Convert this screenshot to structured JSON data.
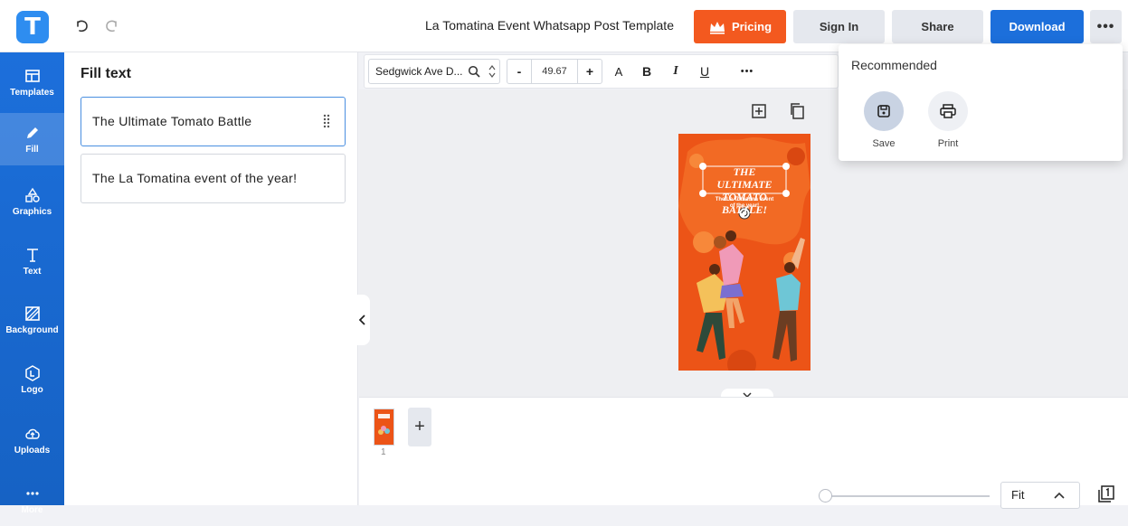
{
  "header": {
    "logo_letter": "T",
    "doc_title": "La Tomatina Event Whatsapp Post Template",
    "pricing_label": "Pricing",
    "signin_label": "Sign In",
    "share_label": "Share",
    "download_label": "Download",
    "more_label": "•••",
    "colors": {
      "pricing": "#f3591f",
      "download": "#1c6fdb",
      "brand": "#2e8df0"
    }
  },
  "sidebar": {
    "items": [
      {
        "label": "Templates",
        "icon": "templates-icon"
      },
      {
        "label": "Fill",
        "icon": "pencil-icon"
      },
      {
        "label": "Graphics",
        "icon": "shapes-icon"
      },
      {
        "label": "Text",
        "icon": "text-icon"
      },
      {
        "label": "Background",
        "icon": "background-icon"
      },
      {
        "label": "Logo",
        "icon": "logo-icon"
      },
      {
        "label": "Uploads",
        "icon": "upload-cloud-icon"
      },
      {
        "label": "More",
        "icon": "more-dots-icon"
      }
    ],
    "active": "Fill"
  },
  "fill_panel": {
    "title": "Fill text",
    "fields": [
      {
        "value": "The Ultimate Tomato Battle"
      },
      {
        "value": "The La Tomatina event of the year!"
      }
    ]
  },
  "toolbar": {
    "font_name": "Sedgwick Ave D...",
    "minus_label": "-",
    "font_size": "49.67",
    "plus_label": "+",
    "text_a": "A",
    "bold": "B",
    "italic": "I",
    "underline": "U",
    "more": "•••"
  },
  "poster": {
    "headline": "THE ULTIMATE TOMATO BATTLE!",
    "subtext": "The La Tomatina event of the year!"
  },
  "pages": {
    "current": "1"
  },
  "zoom": {
    "value": "Fit"
  },
  "download_menu": {
    "title": "Recommended",
    "items": [
      {
        "label": "Save",
        "icon": "save-icon"
      },
      {
        "label": "Print",
        "icon": "print-icon"
      }
    ]
  }
}
